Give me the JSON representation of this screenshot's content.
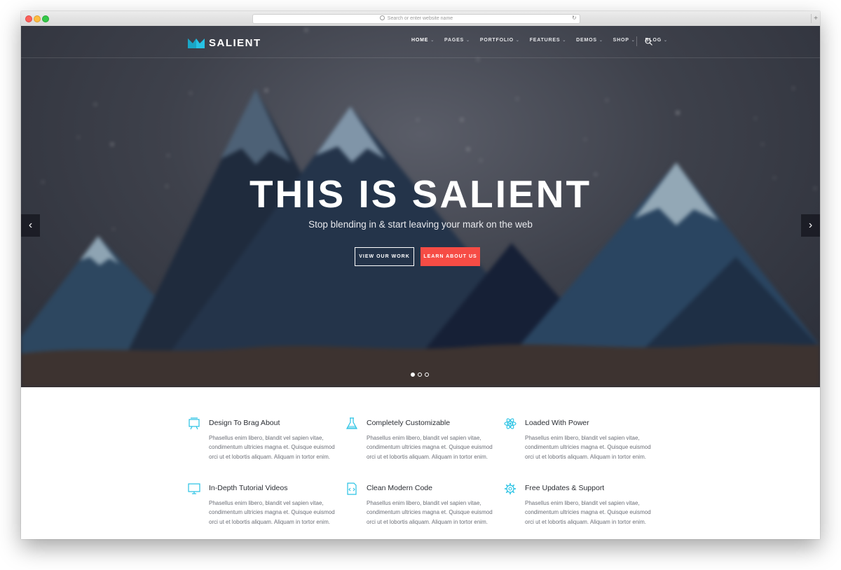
{
  "browser": {
    "url_placeholder": "Search or enter website name",
    "new_tab_label": "+"
  },
  "nav": {
    "logo_text": "SALIENT",
    "items": [
      {
        "label": "HOME"
      },
      {
        "label": "PAGES"
      },
      {
        "label": "PORTFOLIO"
      },
      {
        "label": "FEATURES"
      },
      {
        "label": "DEMOS"
      },
      {
        "label": "SHOP"
      },
      {
        "label": "BLOG"
      }
    ],
    "search_icon": "search-icon"
  },
  "hero": {
    "title": "THIS IS SALIENT",
    "subtitle": "Stop blending in & start leaving your mark on the web",
    "button_primary": "VIEW OUR WORK",
    "button_secondary": "LEARN ABOUT US",
    "prev_arrow": "‹",
    "next_arrow": "›",
    "slide_count": 3,
    "active_slide": 1,
    "accent_color": "#f64c45"
  },
  "features": [
    {
      "title": "Design To Brag About",
      "icon": "easel-icon",
      "text": "Phasellus enim libero, blandit vel sapien vitae, condimentum ultricies magna et. Quisque euismod orci ut et lobortis aliquam. Aliquam in tortor enim."
    },
    {
      "title": "Completely Customizable",
      "icon": "flask-icon",
      "text": "Phasellus enim libero, blandit vel sapien vitae, condimentum ultricies magna et. Quisque euismod orci ut et lobortis aliquam. Aliquam in tortor enim."
    },
    {
      "title": "Loaded With Power",
      "icon": "atom-icon",
      "text": "Phasellus enim libero, blandit vel sapien vitae, condimentum ultricies magna et. Quisque euismod orci ut et lobortis aliquam. Aliquam in tortor enim."
    },
    {
      "title": "In-Depth Tutorial Videos",
      "icon": "monitor-icon",
      "text": "Phasellus enim libero, blandit vel sapien vitae, condimentum ultricies magna et. Quisque euismod orci ut et lobortis aliquam. Aliquam in tortor enim."
    },
    {
      "title": "Clean Modern Code",
      "icon": "code-document-icon",
      "text": "Phasellus enim libero, blandit vel sapien vitae, condimentum ultricies magna et. Quisque euismod orci ut et lobortis aliquam. Aliquam in tortor enim."
    },
    {
      "title": "Free Updates & Support",
      "icon": "gear-icon",
      "text": "Phasellus enim libero, blandit vel sapien vitae, condimentum ultricies magna et. Quisque euismod orci ut et lobortis aliquam. Aliquam in tortor enim."
    }
  ],
  "colors": {
    "icon_accent": "#27c2e4",
    "brand_crown": "#27c2e4"
  }
}
